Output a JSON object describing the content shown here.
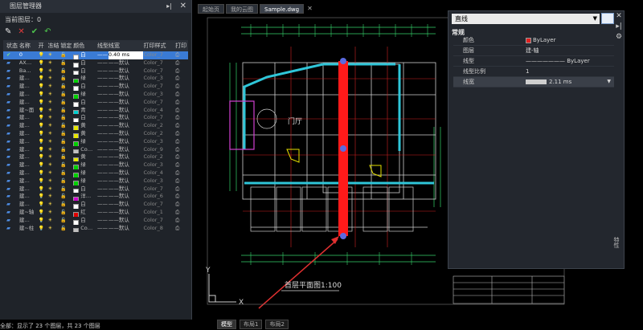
{
  "layer_panel": {
    "title": "图层管理器",
    "current_layer_label": "当前图层：0",
    "toolbar": [
      "new-layer",
      "delete-layer",
      "set-current",
      "refresh"
    ],
    "columns": [
      "状态",
      "名称",
      "开",
      "冻结",
      "锁定",
      "颜色",
      "线型",
      "线宽",
      "打印样式",
      "打印"
    ],
    "rows": [
      {
        "name": "0",
        "color_name": "白",
        "color_hex": "#ffffff",
        "lineweight": "0.40 ms",
        "style": "Color_7",
        "selected": true
      },
      {
        "name": "AX…",
        "color_name": "白",
        "color_hex": "#ffffff",
        "lineweight": "——默认",
        "style": "Color_7"
      },
      {
        "name": "Ba…",
        "color_name": "白",
        "color_hex": "#ffffff",
        "lineweight": "——默认",
        "style": "Color_7"
      },
      {
        "name": "建…",
        "color_name": "绿",
        "color_hex": "#00d000",
        "lineweight": "——默认",
        "style": "Color_3"
      },
      {
        "name": "建…",
        "color_name": "白",
        "color_hex": "#ffffff",
        "lineweight": "——默认",
        "style": "Color_7"
      },
      {
        "name": "建…",
        "color_name": "绿",
        "color_hex": "#00d000",
        "lineweight": "——默认",
        "style": "Color_3"
      },
      {
        "name": "建…",
        "color_name": "白",
        "color_hex": "#ffffff",
        "lineweight": "——默认",
        "style": "Color_7"
      },
      {
        "name": "建~面",
        "color_name": "青",
        "color_hex": "#00d0d0",
        "lineweight": "——默认",
        "style": "Color_4"
      },
      {
        "name": "建…",
        "color_name": "白",
        "color_hex": "#ffffff",
        "lineweight": "——默认",
        "style": "Color_7"
      },
      {
        "name": "建…",
        "color_name": "黄",
        "color_hex": "#e6e600",
        "lineweight": "——默认",
        "style": "Color_2"
      },
      {
        "name": "建…",
        "color_name": "黄",
        "color_hex": "#e6e600",
        "lineweight": "——默认",
        "style": "Color_2"
      },
      {
        "name": "建…",
        "color_name": "绿",
        "color_hex": "#00d000",
        "lineweight": "——默认",
        "style": "Color_3"
      },
      {
        "name": "建…",
        "color_name": "Co…",
        "color_hex": "#c0c0c0",
        "lineweight": "——默认",
        "style": "Color_9"
      },
      {
        "name": "建…",
        "color_name": "黄",
        "color_hex": "#e6e600",
        "lineweight": "——默认",
        "style": "Color_2"
      },
      {
        "name": "建…",
        "color_name": "绿",
        "color_hex": "#00d000",
        "lineweight": "——默认",
        "style": "Color_3"
      },
      {
        "name": "建…",
        "color_name": "绿",
        "color_hex": "#00d000",
        "lineweight": "——默认",
        "style": "Color_4"
      },
      {
        "name": "建…",
        "color_name": "绿",
        "color_hex": "#00d000",
        "lineweight": "——默认",
        "style": "Color_3"
      },
      {
        "name": "建…",
        "color_name": "白",
        "color_hex": "#ffffff",
        "lineweight": "——默认",
        "style": "Color_7"
      },
      {
        "name": "建…",
        "color_name": "洋…",
        "color_hex": "#d000d0",
        "lineweight": "——默认",
        "style": "Color_6"
      },
      {
        "name": "建…",
        "color_name": "白",
        "color_hex": "#ffffff",
        "lineweight": "——默认",
        "style": "Color_7"
      },
      {
        "name": "建~轴",
        "color_name": "红",
        "color_hex": "#e00000",
        "lineweight": "——默认",
        "style": "Color_1"
      },
      {
        "name": "建…",
        "color_name": "白",
        "color_hex": "#ffffff",
        "lineweight": "——默认",
        "style": "Color_7"
      },
      {
        "name": "建~柱",
        "color_name": "Co…",
        "color_hex": "#c0c0c0",
        "lineweight": "——默认",
        "style": "Color_8"
      }
    ],
    "status": "全部：显示了 23 个图层，共 23 个图层"
  },
  "tabs": [
    {
      "label": "起始页",
      "active": false
    },
    {
      "label": "我的云图",
      "active": false
    },
    {
      "label": "Sample.dwg",
      "active": true
    }
  ],
  "bottom_tabs": [
    {
      "label": "模型",
      "active": true
    },
    {
      "label": "布局1",
      "active": false
    },
    {
      "label": "布局2",
      "active": false
    }
  ],
  "drawing": {
    "plan_title": "首层平面图1:100",
    "room_label": "门厅",
    "ucs_y": "Y",
    "ucs_x": "X"
  },
  "properties": {
    "selector": "直线",
    "section": "常规",
    "rows": [
      {
        "key": "颜色",
        "value": "ByLayer",
        "swatch": "#e02020"
      },
      {
        "key": "图层",
        "value": "建-轴"
      },
      {
        "key": "线型",
        "value": "ByLayer"
      },
      {
        "key": "线型比例",
        "value": "1"
      },
      {
        "key": "线宽",
        "value": "2.11 ms",
        "selected": true
      }
    ],
    "side_label": "特性"
  }
}
